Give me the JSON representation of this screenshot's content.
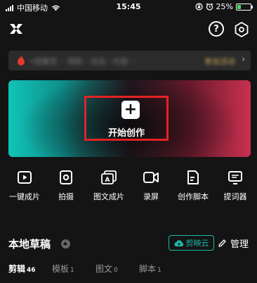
{
  "status_bar": {
    "carrier": "中国移动",
    "time": "15:45",
    "battery_percent": "25%"
  },
  "banner": {
    "text": "•提醒您 ·· 领取···活动···内容···",
    "cta": "参加活动",
    "chevron": "›"
  },
  "hero": {
    "create_label": "开始创作",
    "plus": "+"
  },
  "tools": [
    {
      "label": "一键成片",
      "icon": "play-square-icon"
    },
    {
      "label": "拍摄",
      "icon": "camera-icon"
    },
    {
      "label": "图文成片",
      "icon": "text-to-video-icon"
    },
    {
      "label": "录屏",
      "icon": "screen-record-icon"
    },
    {
      "label": "创作脚本",
      "icon": "script-document-icon"
    },
    {
      "label": "提词器",
      "icon": "teleprompter-icon"
    }
  ],
  "drafts": {
    "title": "本地草稿",
    "cloud_label": "剪映云",
    "manage_label": "管理"
  },
  "tabs": [
    {
      "label": "剪辑",
      "count": "46",
      "active": true
    },
    {
      "label": "模板",
      "count": "1",
      "active": false
    },
    {
      "label": "图文",
      "count": "0",
      "active": false
    },
    {
      "label": "脚本",
      "count": "1",
      "active": false
    }
  ],
  "colors": {
    "accent_teal": "#1db9a9",
    "highlight_red": "#e32222",
    "background": "#141414"
  }
}
